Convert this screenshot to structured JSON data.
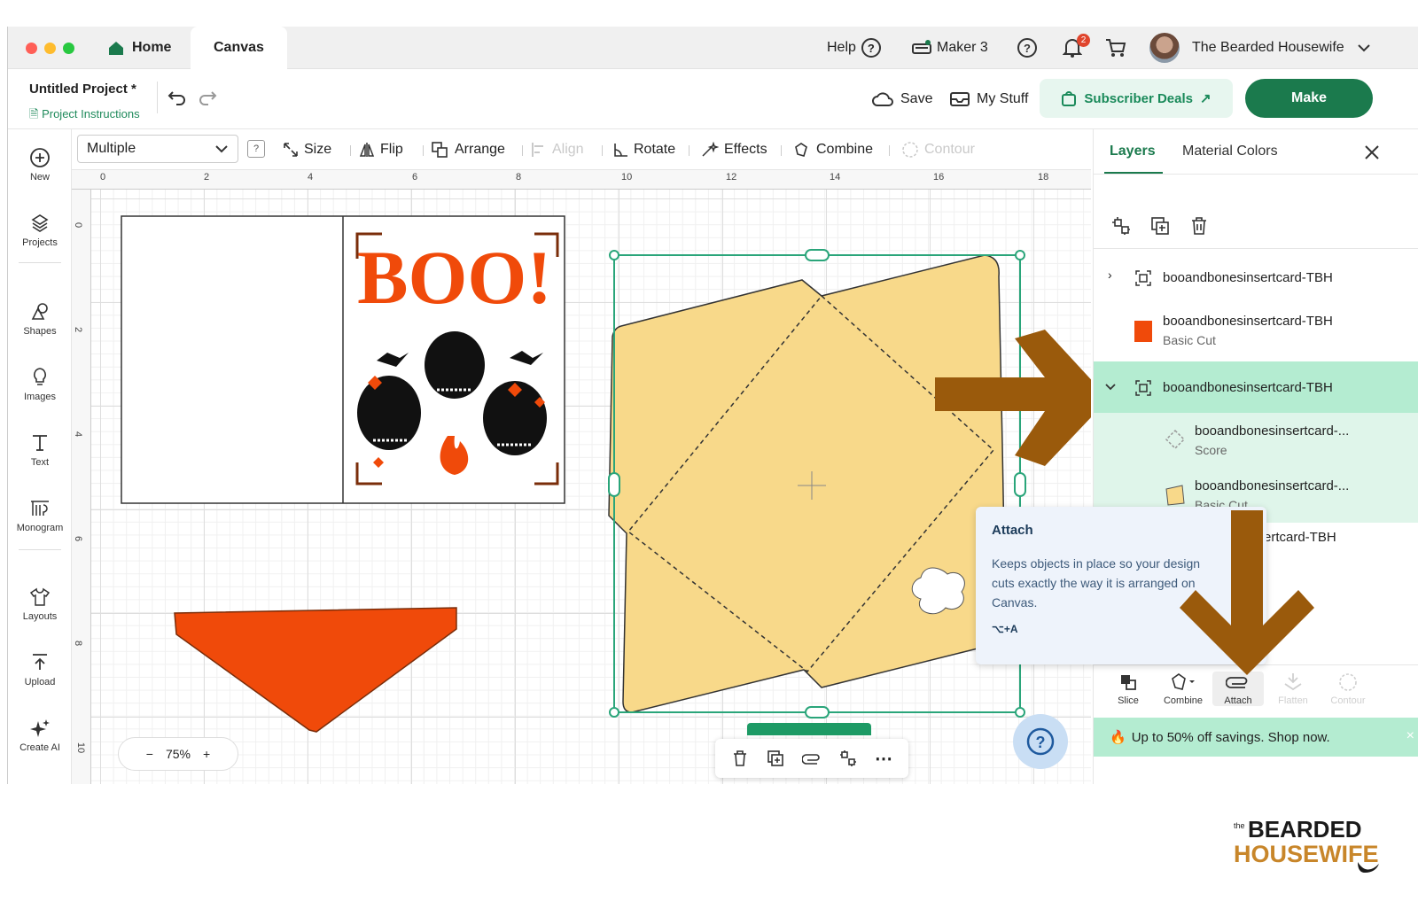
{
  "tabbar": {
    "home_label": "Home",
    "canvas_label": "Canvas",
    "help_label": "Help",
    "machine_label": "Maker 3",
    "notification_count": "2",
    "user_name": "The Bearded Housewife"
  },
  "header": {
    "project_title": "Untitled Project *",
    "project_instructions": "Project Instructions",
    "save_label": "Save",
    "mystuff_label": "My Stuff",
    "subscriber_label": "Subscriber Deals",
    "make_label": "Make"
  },
  "sidebar": {
    "items": [
      {
        "label": "New",
        "icon": "plus-circle-icon"
      },
      {
        "label": "Projects",
        "icon": "projects-icon"
      },
      {
        "label": "Shapes",
        "icon": "shapes-icon"
      },
      {
        "label": "Images",
        "icon": "lightbulb-icon"
      },
      {
        "label": "Text",
        "icon": "text-icon"
      },
      {
        "label": "Monogram",
        "icon": "monogram-icon"
      },
      {
        "label": "Layouts",
        "icon": "shirt-icon"
      },
      {
        "label": "Upload",
        "icon": "upload-icon"
      },
      {
        "label": "Create AI",
        "icon": "sparkle-icon"
      }
    ]
  },
  "toolbar": {
    "select_value": "Multiple",
    "help_box": "?",
    "size_label": "Size",
    "flip_label": "Flip",
    "arrange_label": "Arrange",
    "align_label": "Align",
    "rotate_label": "Rotate",
    "effects_label": "Effects",
    "combine_label": "Combine",
    "contour_label": "Contour"
  },
  "canvas": {
    "ruler_top": [
      "0",
      "2",
      "4",
      "6",
      "8",
      "10",
      "12",
      "14",
      "16",
      "18"
    ],
    "ruler_left": [
      "0",
      "2",
      "4",
      "6",
      "8",
      "10"
    ],
    "card_text": "BOO!",
    "zoom_minus": "−",
    "zoom_value": "75%",
    "zoom_plus": "+",
    "float_more": "⋯",
    "help_glyph": "?"
  },
  "panel": {
    "tab_layers": "Layers",
    "tab_material_colors": "Material Colors",
    "layers": [
      {
        "name": "booandbonesinsertcard-TBH",
        "sub": ""
      },
      {
        "name": "booandbonesinsertcard-TBH",
        "sub": "Basic Cut"
      },
      {
        "name": "booandbonesinsertcard-TBH",
        "sub": ""
      },
      {
        "name": "booandbonesinsertcard-...",
        "sub": "Score"
      },
      {
        "name": "booandbonesinsertcard-...",
        "sub": "Basic Cut"
      },
      {
        "name": "ertcard-TBH",
        "sub": ""
      }
    ],
    "tooltip": {
      "title": "Attach",
      "body": "Keeps objects in place so your design cuts exactly the way it is arranged on Canvas.",
      "shortcut": "⌥+A"
    },
    "bottom_tools": [
      {
        "label": "Slice",
        "enabled": true
      },
      {
        "label": "Combine",
        "enabled": true
      },
      {
        "label": "Attach",
        "enabled": true
      },
      {
        "label": "Flatten",
        "enabled": false
      },
      {
        "label": "Contour",
        "enabled": false
      }
    ],
    "promo_text": "Up to 50% off savings. Shop now.",
    "promo_close": "×"
  },
  "watermark": {
    "line1": "BEARDED",
    "line2": "HOUSEWIFE",
    "small": "the"
  },
  "colors": {
    "accent_green": "#1b7a4d",
    "selection_green": "#b4ecd1",
    "envelope_yellow": "#f8d98a",
    "orange": "#f04a0a",
    "arrow_brown": "#9a5a0c"
  }
}
